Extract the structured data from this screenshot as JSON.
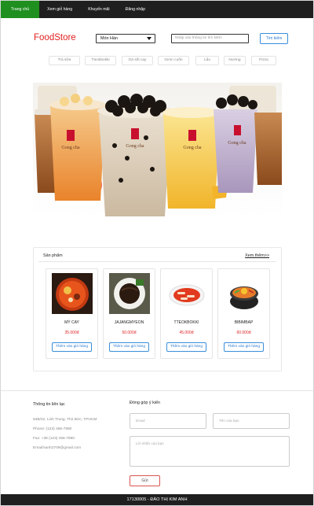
{
  "nav": {
    "items": [
      {
        "label": "Trang chủ",
        "active": true
      },
      {
        "label": "Xem giỏ hàng",
        "active": false
      },
      {
        "label": "Khuyến mãi",
        "active": false
      },
      {
        "label": "Đăng nhập",
        "active": false
      }
    ],
    "active_color": "#1f8f1f",
    "bar_color": "#1f1f1f"
  },
  "header": {
    "logo": "FoodStore",
    "logo_color": "#e21e1e",
    "select_value": "Món Hàn",
    "search_placeholder": "Nhập vào thông tin tìm kiếm",
    "search_button": "Tìm kiếm"
  },
  "categories": [
    "Trà sữa",
    "Tteokbokki",
    "Gà sốt cay",
    "Gimn cuốn",
    "Lẩu",
    "Nướng",
    "Pizza"
  ],
  "banner": {
    "cup_labels": [
      "Gong cha",
      "Gong cha",
      "Gong cha",
      "Gong cha"
    ]
  },
  "products": {
    "title": "Sản phẩm",
    "more_link": "Xem thêm>>",
    "items": [
      {
        "name": "MỲ CAY",
        "price": "35.000đ",
        "button": "Thêm vào giỏ hàng"
      },
      {
        "name": "JAJANGMYEON",
        "price": "50.000đ",
        "button": "Thêm vào giỏ hàng"
      },
      {
        "name": "TTEOKBOKKI",
        "price": "45.000đ",
        "button": "Thêm vào giỏ hàng"
      },
      {
        "name": "BIBIMBAP",
        "price": "60.000đ",
        "button": "Thêm vào giỏ hàng"
      }
    ]
  },
  "contact": {
    "title": "Thông tin liên lạc",
    "lines": [
      "94B/22, Linh Trung, Thủ Đức, TPHCM",
      "Phone: (123) 456-7890",
      "Fax: +38 (123) 456-7890",
      "Email:kanh2709@gmail.com"
    ]
  },
  "feedback": {
    "title": "Đóng góp ý kiến",
    "email_placeholder": "Email",
    "name_placeholder": "Tên của bạn",
    "message_placeholder": "Lời nhắn của bạn",
    "send_button": "Gửi"
  },
  "footer": {
    "text": "17130005 - ĐÀO THỊ KIM ANH"
  }
}
